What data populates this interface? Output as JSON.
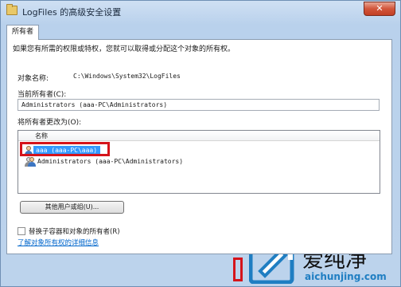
{
  "window": {
    "title": "LogFiles 的高级安全设置",
    "close_glyph": "✕"
  },
  "tab": {
    "label": "所有者"
  },
  "intro_text": "如果您有所需的权限或特权，您就可以取得或分配这个对象的所有权。",
  "object_name": {
    "label": "对象名称:",
    "value": "C:\\Windows\\System32\\LogFiles"
  },
  "current_owner": {
    "label": "当前所有者(C):",
    "value": "Administrators (aaa-PC\\Administrators)"
  },
  "change_owner": {
    "label": "将所有者更改为(O):",
    "column_header": "名称",
    "items": [
      {
        "name": "aaa (aaa-PC\\aaa)",
        "icon": "user-icon",
        "selected": true
      },
      {
        "name": "Administrators (aaa-PC\\Administrators)",
        "icon": "group-icon",
        "selected": false
      }
    ]
  },
  "other_users_button": "其他用户或组(U)...",
  "replace_checkbox": {
    "label": "替换子容器和对象的所有者(R)",
    "checked": false
  },
  "details_link": "了解对象所有权的详细信息",
  "watermark": {
    "text": "爱纯净",
    "url": "aichunjing.com"
  },
  "colors": {
    "highlight_red": "#d5141b",
    "selection_blue": "#3399ff",
    "link_blue": "#0066cc"
  }
}
